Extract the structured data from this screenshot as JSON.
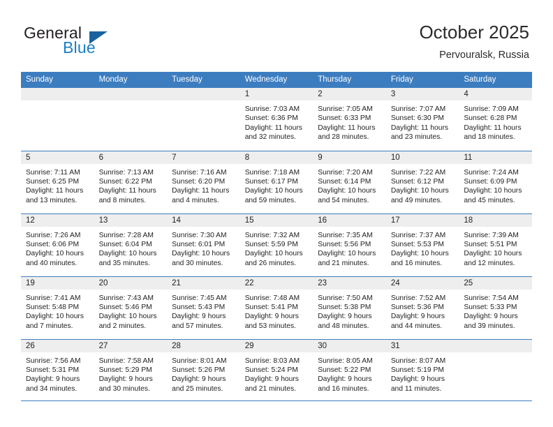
{
  "brand": {
    "name_part1": "General",
    "name_part2": "Blue",
    "triangle_color": "#18639f",
    "blue_text_color": "#1b7fc4"
  },
  "header": {
    "title": "October 2025",
    "location": "Pervouralsk, Russia"
  },
  "theme": {
    "header_row_bg": "#3c7dc0",
    "daynum_band_bg": "#eeeeee",
    "row_border": "#3c7dc0",
    "text": "#222222"
  },
  "weekdays": [
    "Sunday",
    "Monday",
    "Tuesday",
    "Wednesday",
    "Thursday",
    "Friday",
    "Saturday"
  ],
  "weeks": [
    [
      {
        "day": "",
        "sunrise": "",
        "sunset": "",
        "daylight_line1": "",
        "daylight_line2": ""
      },
      {
        "day": "",
        "sunrise": "",
        "sunset": "",
        "daylight_line1": "",
        "daylight_line2": ""
      },
      {
        "day": "",
        "sunrise": "",
        "sunset": "",
        "daylight_line1": "",
        "daylight_line2": ""
      },
      {
        "day": "1",
        "sunrise": "Sunrise: 7:03 AM",
        "sunset": "Sunset: 6:36 PM",
        "daylight_line1": "Daylight: 11 hours",
        "daylight_line2": "and 32 minutes."
      },
      {
        "day": "2",
        "sunrise": "Sunrise: 7:05 AM",
        "sunset": "Sunset: 6:33 PM",
        "daylight_line1": "Daylight: 11 hours",
        "daylight_line2": "and 28 minutes."
      },
      {
        "day": "3",
        "sunrise": "Sunrise: 7:07 AM",
        "sunset": "Sunset: 6:30 PM",
        "daylight_line1": "Daylight: 11 hours",
        "daylight_line2": "and 23 minutes."
      },
      {
        "day": "4",
        "sunrise": "Sunrise: 7:09 AM",
        "sunset": "Sunset: 6:28 PM",
        "daylight_line1": "Daylight: 11 hours",
        "daylight_line2": "and 18 minutes."
      }
    ],
    [
      {
        "day": "5",
        "sunrise": "Sunrise: 7:11 AM",
        "sunset": "Sunset: 6:25 PM",
        "daylight_line1": "Daylight: 11 hours",
        "daylight_line2": "and 13 minutes."
      },
      {
        "day": "6",
        "sunrise": "Sunrise: 7:13 AM",
        "sunset": "Sunset: 6:22 PM",
        "daylight_line1": "Daylight: 11 hours",
        "daylight_line2": "and 8 minutes."
      },
      {
        "day": "7",
        "sunrise": "Sunrise: 7:16 AM",
        "sunset": "Sunset: 6:20 PM",
        "daylight_line1": "Daylight: 11 hours",
        "daylight_line2": "and 4 minutes."
      },
      {
        "day": "8",
        "sunrise": "Sunrise: 7:18 AM",
        "sunset": "Sunset: 6:17 PM",
        "daylight_line1": "Daylight: 10 hours",
        "daylight_line2": "and 59 minutes."
      },
      {
        "day": "9",
        "sunrise": "Sunrise: 7:20 AM",
        "sunset": "Sunset: 6:14 PM",
        "daylight_line1": "Daylight: 10 hours",
        "daylight_line2": "and 54 minutes."
      },
      {
        "day": "10",
        "sunrise": "Sunrise: 7:22 AM",
        "sunset": "Sunset: 6:12 PM",
        "daylight_line1": "Daylight: 10 hours",
        "daylight_line2": "and 49 minutes."
      },
      {
        "day": "11",
        "sunrise": "Sunrise: 7:24 AM",
        "sunset": "Sunset: 6:09 PM",
        "daylight_line1": "Daylight: 10 hours",
        "daylight_line2": "and 45 minutes."
      }
    ],
    [
      {
        "day": "12",
        "sunrise": "Sunrise: 7:26 AM",
        "sunset": "Sunset: 6:06 PM",
        "daylight_line1": "Daylight: 10 hours",
        "daylight_line2": "and 40 minutes."
      },
      {
        "day": "13",
        "sunrise": "Sunrise: 7:28 AM",
        "sunset": "Sunset: 6:04 PM",
        "daylight_line1": "Daylight: 10 hours",
        "daylight_line2": "and 35 minutes."
      },
      {
        "day": "14",
        "sunrise": "Sunrise: 7:30 AM",
        "sunset": "Sunset: 6:01 PM",
        "daylight_line1": "Daylight: 10 hours",
        "daylight_line2": "and 30 minutes."
      },
      {
        "day": "15",
        "sunrise": "Sunrise: 7:32 AM",
        "sunset": "Sunset: 5:59 PM",
        "daylight_line1": "Daylight: 10 hours",
        "daylight_line2": "and 26 minutes."
      },
      {
        "day": "16",
        "sunrise": "Sunrise: 7:35 AM",
        "sunset": "Sunset: 5:56 PM",
        "daylight_line1": "Daylight: 10 hours",
        "daylight_line2": "and 21 minutes."
      },
      {
        "day": "17",
        "sunrise": "Sunrise: 7:37 AM",
        "sunset": "Sunset: 5:53 PM",
        "daylight_line1": "Daylight: 10 hours",
        "daylight_line2": "and 16 minutes."
      },
      {
        "day": "18",
        "sunrise": "Sunrise: 7:39 AM",
        "sunset": "Sunset: 5:51 PM",
        "daylight_line1": "Daylight: 10 hours",
        "daylight_line2": "and 12 minutes."
      }
    ],
    [
      {
        "day": "19",
        "sunrise": "Sunrise: 7:41 AM",
        "sunset": "Sunset: 5:48 PM",
        "daylight_line1": "Daylight: 10 hours",
        "daylight_line2": "and 7 minutes."
      },
      {
        "day": "20",
        "sunrise": "Sunrise: 7:43 AM",
        "sunset": "Sunset: 5:46 PM",
        "daylight_line1": "Daylight: 10 hours",
        "daylight_line2": "and 2 minutes."
      },
      {
        "day": "21",
        "sunrise": "Sunrise: 7:45 AM",
        "sunset": "Sunset: 5:43 PM",
        "daylight_line1": "Daylight: 9 hours",
        "daylight_line2": "and 57 minutes."
      },
      {
        "day": "22",
        "sunrise": "Sunrise: 7:48 AM",
        "sunset": "Sunset: 5:41 PM",
        "daylight_line1": "Daylight: 9 hours",
        "daylight_line2": "and 53 minutes."
      },
      {
        "day": "23",
        "sunrise": "Sunrise: 7:50 AM",
        "sunset": "Sunset: 5:38 PM",
        "daylight_line1": "Daylight: 9 hours",
        "daylight_line2": "and 48 minutes."
      },
      {
        "day": "24",
        "sunrise": "Sunrise: 7:52 AM",
        "sunset": "Sunset: 5:36 PM",
        "daylight_line1": "Daylight: 9 hours",
        "daylight_line2": "and 44 minutes."
      },
      {
        "day": "25",
        "sunrise": "Sunrise: 7:54 AM",
        "sunset": "Sunset: 5:33 PM",
        "daylight_line1": "Daylight: 9 hours",
        "daylight_line2": "and 39 minutes."
      }
    ],
    [
      {
        "day": "26",
        "sunrise": "Sunrise: 7:56 AM",
        "sunset": "Sunset: 5:31 PM",
        "daylight_line1": "Daylight: 9 hours",
        "daylight_line2": "and 34 minutes."
      },
      {
        "day": "27",
        "sunrise": "Sunrise: 7:58 AM",
        "sunset": "Sunset: 5:29 PM",
        "daylight_line1": "Daylight: 9 hours",
        "daylight_line2": "and 30 minutes."
      },
      {
        "day": "28",
        "sunrise": "Sunrise: 8:01 AM",
        "sunset": "Sunset: 5:26 PM",
        "daylight_line1": "Daylight: 9 hours",
        "daylight_line2": "and 25 minutes."
      },
      {
        "day": "29",
        "sunrise": "Sunrise: 8:03 AM",
        "sunset": "Sunset: 5:24 PM",
        "daylight_line1": "Daylight: 9 hours",
        "daylight_line2": "and 21 minutes."
      },
      {
        "day": "30",
        "sunrise": "Sunrise: 8:05 AM",
        "sunset": "Sunset: 5:22 PM",
        "daylight_line1": "Daylight: 9 hours",
        "daylight_line2": "and 16 minutes."
      },
      {
        "day": "31",
        "sunrise": "Sunrise: 8:07 AM",
        "sunset": "Sunset: 5:19 PM",
        "daylight_line1": "Daylight: 9 hours",
        "daylight_line2": "and 11 minutes."
      },
      {
        "day": "",
        "sunrise": "",
        "sunset": "",
        "daylight_line1": "",
        "daylight_line2": ""
      }
    ]
  ]
}
